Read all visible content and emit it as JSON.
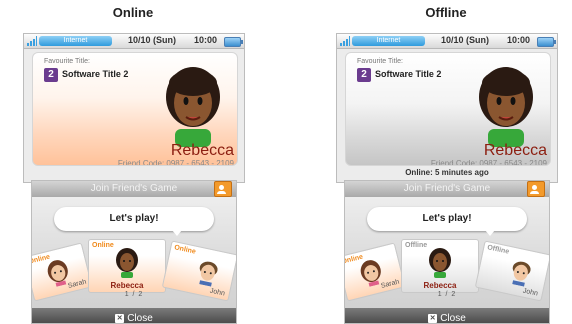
{
  "panels": [
    {
      "heading": "Online",
      "status_bar": {
        "network": "Internet",
        "date": "10/10 (Sun)",
        "time": "10:00"
      },
      "profile": {
        "fav_label": "Favourite Title:",
        "fav_badge": "2",
        "fav_title": "Software Title 2",
        "name": "Rebecca",
        "friend_code": "Friend Code: 0987 - 6543 - 2109",
        "presence": ""
      },
      "bottom": {
        "join_label": "Join Friend's Game",
        "speech": "Let's play!",
        "cards": [
          {
            "status": "Online",
            "name": "Sarah"
          },
          {
            "status": "Online",
            "name": "Rebecca"
          },
          {
            "status": "Online",
            "name": "John"
          }
        ],
        "pager": "1 / 2",
        "close_label": "Close",
        "close_icon_glyph": "✕"
      },
      "theme": "online"
    },
    {
      "heading": "Offline",
      "status_bar": {
        "network": "Internet",
        "date": "10/10 (Sun)",
        "time": "10:00"
      },
      "profile": {
        "fav_label": "Favourite Title:",
        "fav_badge": "2",
        "fav_title": "Software Title 2",
        "name": "Rebecca",
        "friend_code": "Friend Code: 0987 - 6543 - 2109",
        "presence": "Online: 5 minutes ago"
      },
      "bottom": {
        "join_label": "Join Friend's Game",
        "speech": "Let's play!",
        "cards": [
          {
            "status": "Online",
            "name": "Sarah"
          },
          {
            "status": "Offline",
            "name": "Rebecca"
          },
          {
            "status": "Offline",
            "name": "John"
          }
        ],
        "pager": "1 / 2",
        "close_label": "Close",
        "close_icon_glyph": "✕"
      },
      "theme": "offline"
    }
  ],
  "colors": {
    "accent_online": "#f08a1c",
    "name_color": "#8c1e10",
    "internet_blue": "#2f9bdd",
    "badge_purple": "#6b3c8f"
  },
  "icons": [
    "wifi-icon",
    "battery-icon",
    "friend-list-icon",
    "close-icon",
    "mii-avatar"
  ]
}
